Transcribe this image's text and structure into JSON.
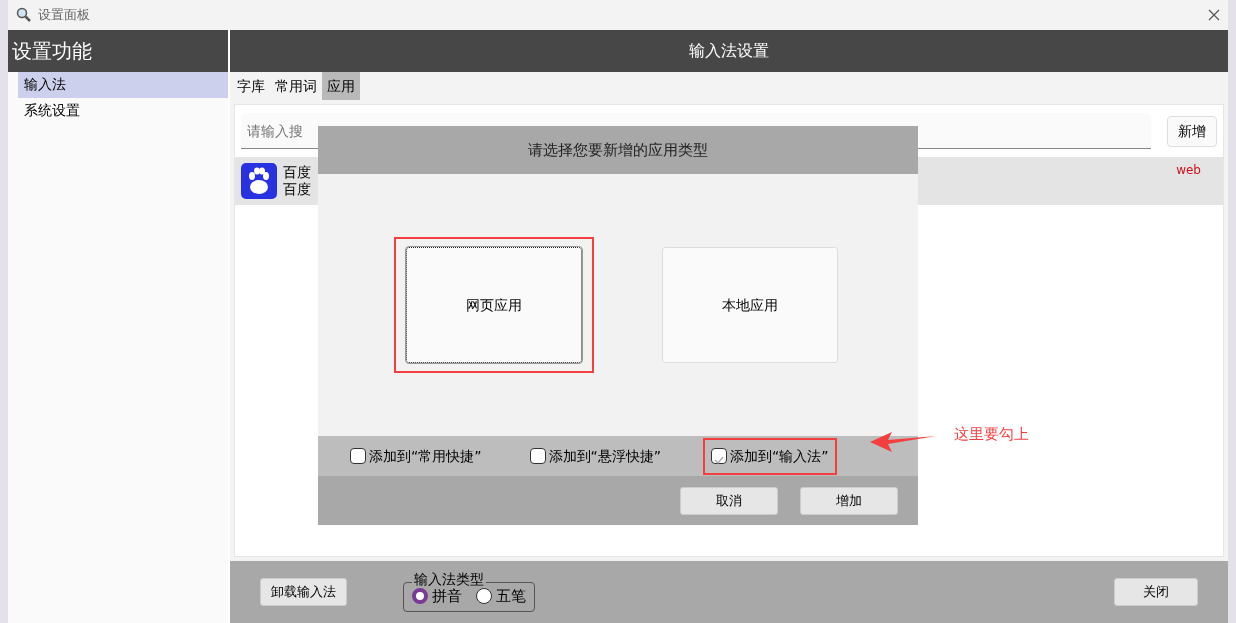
{
  "window": {
    "title": "设置面板"
  },
  "sidebar": {
    "title": "设置功能",
    "items": [
      {
        "label": "输入法",
        "selected": true
      },
      {
        "label": "系统设置",
        "selected": false
      }
    ]
  },
  "main": {
    "title": "输入法设置",
    "tabs": [
      {
        "label": "字库",
        "selected": false
      },
      {
        "label": "常用词",
        "selected": false
      },
      {
        "label": "应用",
        "selected": true
      }
    ],
    "search": {
      "placeholder": "请输入搜"
    },
    "add_button": "新增",
    "apps": [
      {
        "name": "百度",
        "description": "百度",
        "tag": "web"
      }
    ]
  },
  "dialog": {
    "title": "请选择您要新增的应用类型",
    "options": [
      {
        "label": "网页应用",
        "selected": true,
        "highlighted": true
      },
      {
        "label": "本地应用",
        "selected": false,
        "highlighted": false
      }
    ],
    "checkboxes": [
      {
        "label": "添加到“常用快捷”",
        "checked": false,
        "highlighted": false
      },
      {
        "label": "添加到“悬浮快捷”",
        "checked": false,
        "highlighted": false
      },
      {
        "label": "添加到“输入法”",
        "checked": true,
        "highlighted": true
      }
    ],
    "buttons": [
      "取消",
      "增加"
    ]
  },
  "annotation": {
    "text": "这里要勾上"
  },
  "footer": {
    "uninstall_button": "卸载输入法",
    "type_group": {
      "legend": "输入法类型",
      "options": [
        {
          "label": "拼音",
          "selected": true
        },
        {
          "label": "五笔",
          "selected": false
        }
      ]
    },
    "close_button": "关闭"
  }
}
